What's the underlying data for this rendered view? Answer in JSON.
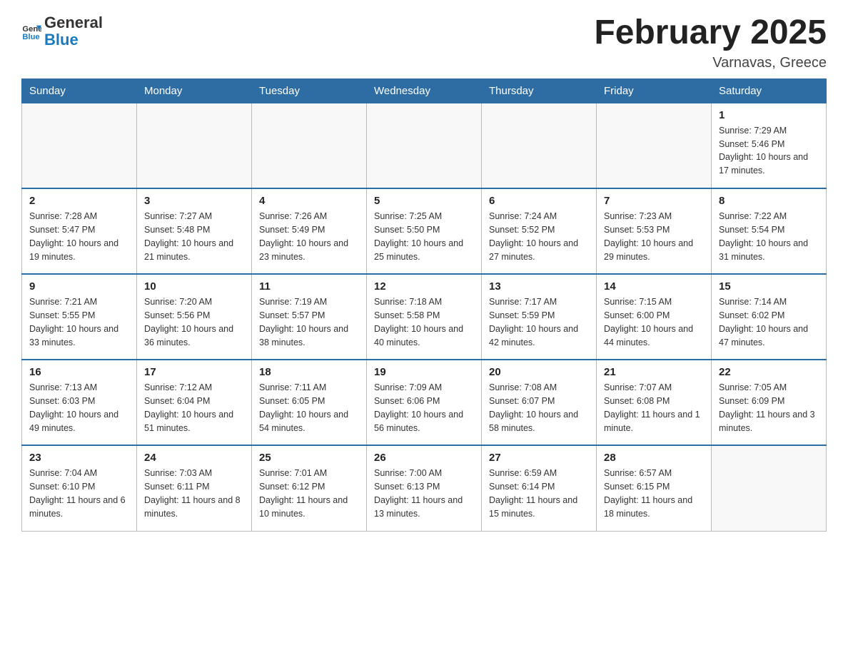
{
  "header": {
    "logo": {
      "text_general": "General",
      "text_blue": "Blue"
    },
    "title": "February 2025",
    "location": "Varnavas, Greece"
  },
  "weekdays": [
    "Sunday",
    "Monday",
    "Tuesday",
    "Wednesday",
    "Thursday",
    "Friday",
    "Saturday"
  ],
  "weeks": [
    [
      {
        "day": "",
        "info": ""
      },
      {
        "day": "",
        "info": ""
      },
      {
        "day": "",
        "info": ""
      },
      {
        "day": "",
        "info": ""
      },
      {
        "day": "",
        "info": ""
      },
      {
        "day": "",
        "info": ""
      },
      {
        "day": "1",
        "info": "Sunrise: 7:29 AM\nSunset: 5:46 PM\nDaylight: 10 hours and 17 minutes."
      }
    ],
    [
      {
        "day": "2",
        "info": "Sunrise: 7:28 AM\nSunset: 5:47 PM\nDaylight: 10 hours and 19 minutes."
      },
      {
        "day": "3",
        "info": "Sunrise: 7:27 AM\nSunset: 5:48 PM\nDaylight: 10 hours and 21 minutes."
      },
      {
        "day": "4",
        "info": "Sunrise: 7:26 AM\nSunset: 5:49 PM\nDaylight: 10 hours and 23 minutes."
      },
      {
        "day": "5",
        "info": "Sunrise: 7:25 AM\nSunset: 5:50 PM\nDaylight: 10 hours and 25 minutes."
      },
      {
        "day": "6",
        "info": "Sunrise: 7:24 AM\nSunset: 5:52 PM\nDaylight: 10 hours and 27 minutes."
      },
      {
        "day": "7",
        "info": "Sunrise: 7:23 AM\nSunset: 5:53 PM\nDaylight: 10 hours and 29 minutes."
      },
      {
        "day": "8",
        "info": "Sunrise: 7:22 AM\nSunset: 5:54 PM\nDaylight: 10 hours and 31 minutes."
      }
    ],
    [
      {
        "day": "9",
        "info": "Sunrise: 7:21 AM\nSunset: 5:55 PM\nDaylight: 10 hours and 33 minutes."
      },
      {
        "day": "10",
        "info": "Sunrise: 7:20 AM\nSunset: 5:56 PM\nDaylight: 10 hours and 36 minutes."
      },
      {
        "day": "11",
        "info": "Sunrise: 7:19 AM\nSunset: 5:57 PM\nDaylight: 10 hours and 38 minutes."
      },
      {
        "day": "12",
        "info": "Sunrise: 7:18 AM\nSunset: 5:58 PM\nDaylight: 10 hours and 40 minutes."
      },
      {
        "day": "13",
        "info": "Sunrise: 7:17 AM\nSunset: 5:59 PM\nDaylight: 10 hours and 42 minutes."
      },
      {
        "day": "14",
        "info": "Sunrise: 7:15 AM\nSunset: 6:00 PM\nDaylight: 10 hours and 44 minutes."
      },
      {
        "day": "15",
        "info": "Sunrise: 7:14 AM\nSunset: 6:02 PM\nDaylight: 10 hours and 47 minutes."
      }
    ],
    [
      {
        "day": "16",
        "info": "Sunrise: 7:13 AM\nSunset: 6:03 PM\nDaylight: 10 hours and 49 minutes."
      },
      {
        "day": "17",
        "info": "Sunrise: 7:12 AM\nSunset: 6:04 PM\nDaylight: 10 hours and 51 minutes."
      },
      {
        "day": "18",
        "info": "Sunrise: 7:11 AM\nSunset: 6:05 PM\nDaylight: 10 hours and 54 minutes."
      },
      {
        "day": "19",
        "info": "Sunrise: 7:09 AM\nSunset: 6:06 PM\nDaylight: 10 hours and 56 minutes."
      },
      {
        "day": "20",
        "info": "Sunrise: 7:08 AM\nSunset: 6:07 PM\nDaylight: 10 hours and 58 minutes."
      },
      {
        "day": "21",
        "info": "Sunrise: 7:07 AM\nSunset: 6:08 PM\nDaylight: 11 hours and 1 minute."
      },
      {
        "day": "22",
        "info": "Sunrise: 7:05 AM\nSunset: 6:09 PM\nDaylight: 11 hours and 3 minutes."
      }
    ],
    [
      {
        "day": "23",
        "info": "Sunrise: 7:04 AM\nSunset: 6:10 PM\nDaylight: 11 hours and 6 minutes."
      },
      {
        "day": "24",
        "info": "Sunrise: 7:03 AM\nSunset: 6:11 PM\nDaylight: 11 hours and 8 minutes."
      },
      {
        "day": "25",
        "info": "Sunrise: 7:01 AM\nSunset: 6:12 PM\nDaylight: 11 hours and 10 minutes."
      },
      {
        "day": "26",
        "info": "Sunrise: 7:00 AM\nSunset: 6:13 PM\nDaylight: 11 hours and 13 minutes."
      },
      {
        "day": "27",
        "info": "Sunrise: 6:59 AM\nSunset: 6:14 PM\nDaylight: 11 hours and 15 minutes."
      },
      {
        "day": "28",
        "info": "Sunrise: 6:57 AM\nSunset: 6:15 PM\nDaylight: 11 hours and 18 minutes."
      },
      {
        "day": "",
        "info": ""
      }
    ]
  ]
}
